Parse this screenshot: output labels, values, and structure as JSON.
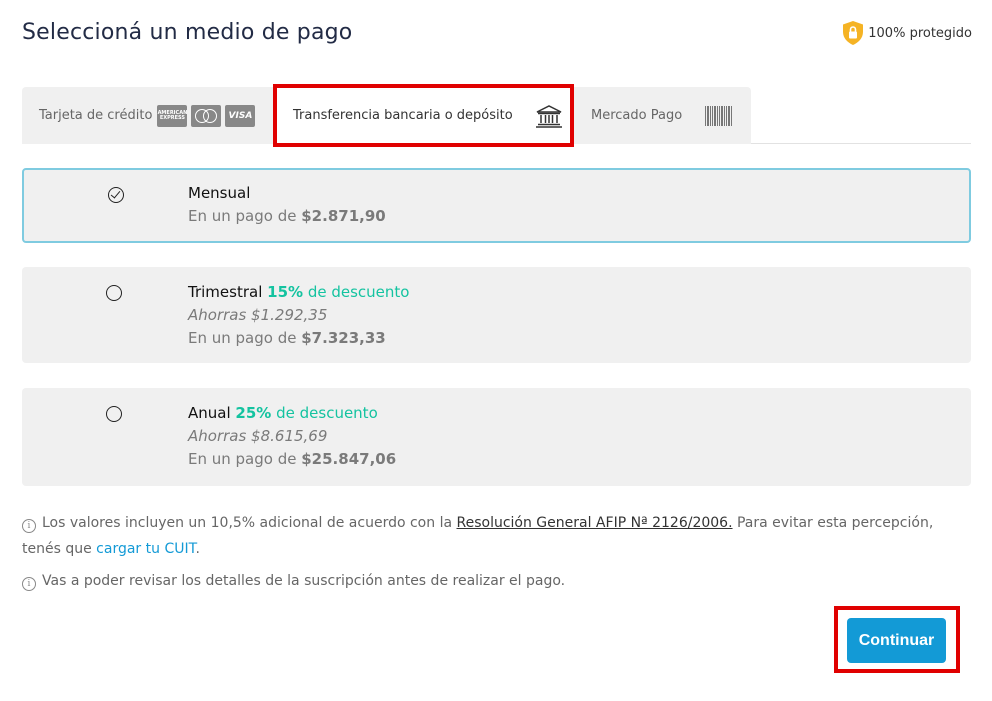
{
  "header": {
    "title": "Seleccioná un medio de pago",
    "protected_label": "100% protegido"
  },
  "tabs": {
    "credit_card": {
      "label": "Tarjeta de crédito",
      "logos": [
        "AMERICAN EXPRESS",
        "mastercard",
        "VISA"
      ]
    },
    "transfer": {
      "label": "Transferencia bancaria o depósito"
    },
    "mercado_pago": {
      "label": "Mercado Pago"
    }
  },
  "plans": [
    {
      "name": "Mensual",
      "discount_pct": "",
      "discount_text": "",
      "savings": "",
      "price_prefix": "En un pago de",
      "price": "$2.871,90",
      "selected": true
    },
    {
      "name": "Trimestral",
      "discount_pct": "15%",
      "discount_text": "de descuento",
      "savings": "Ahorras $1.292,35",
      "price_prefix": "En un pago de",
      "price": "$7.323,33",
      "selected": false
    },
    {
      "name": "Anual",
      "discount_pct": "25%",
      "discount_text": "de descuento",
      "savings": "Ahorras $8.615,69",
      "price_prefix": "En un pago de",
      "price": "$25.847,06",
      "selected": false
    }
  ],
  "notes": {
    "note1_before": "Los valores incluyen un 10,5% adicional de acuerdo con la",
    "note1_link": "Resolución General AFIP Nª 2126/2006.",
    "note1_after": "Para evitar esta percepción, tenés que",
    "note1_link2": "cargar tu CUIT",
    "note1_end": ".",
    "note2": "Vas a poder revisar los detalles de la suscripción antes de realizar el pago."
  },
  "actions": {
    "continue_label": "Continuar"
  },
  "colors": {
    "accent": "#139ad6",
    "discount": "#14c3a0",
    "highlight": "#e00000",
    "shield": "#f5b324"
  },
  "icons": [
    "shield-lock-icon",
    "bank-icon",
    "barcode-icon",
    "check-icon",
    "info-icon"
  ]
}
